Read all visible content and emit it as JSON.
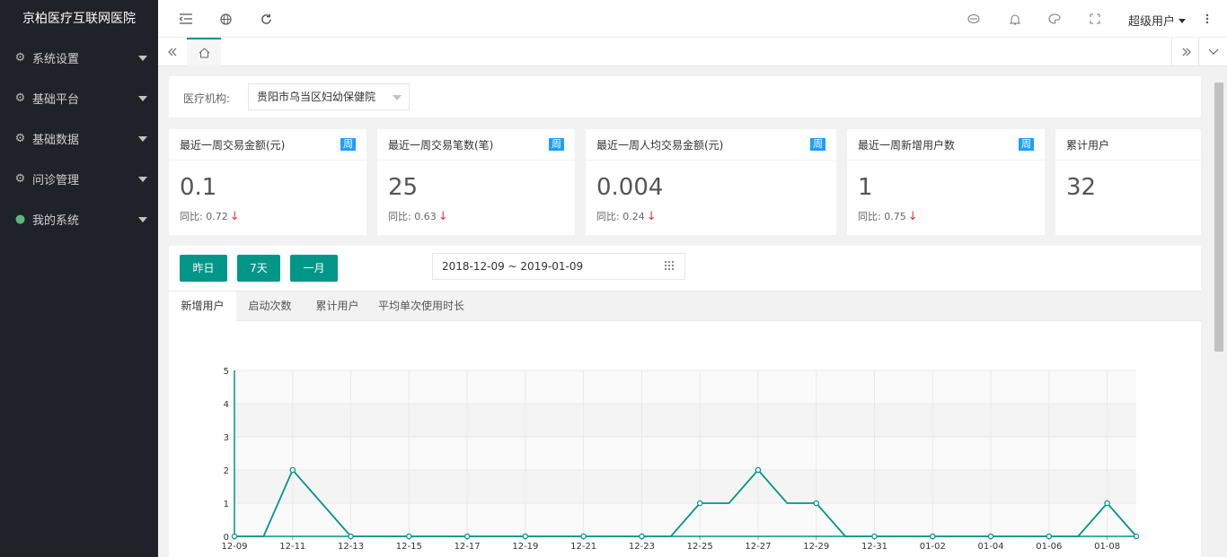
{
  "app": {
    "title": "京柏医疗互联网医院"
  },
  "sidebar": {
    "items": [
      {
        "label": "系统设置",
        "icon": "gear-icon"
      },
      {
        "label": "基础平台",
        "icon": "gear-icon"
      },
      {
        "label": "基础数据",
        "icon": "gear-icon"
      },
      {
        "label": "问诊管理",
        "icon": "gear-icon"
      },
      {
        "label": "我的系统",
        "icon": "wechat-icon"
      }
    ]
  },
  "header": {
    "user": "超级用户"
  },
  "filter": {
    "label": "医疗机构:",
    "selected": "贵阳市乌当区妇幼保健院"
  },
  "cards": [
    {
      "title": "最近一周交易金额(元)",
      "badge": "周",
      "value": "0.1",
      "yoy": "同比: 0.72"
    },
    {
      "title": "最近一周交易笔数(笔)",
      "badge": "周",
      "value": "25",
      "yoy": "同比: 0.63"
    },
    {
      "title": "最近一周人均交易金额(元)",
      "badge": "周",
      "value": "0.004",
      "yoy": "同比: 0.24"
    },
    {
      "title": "最近一周新增用户数",
      "badge": "周",
      "value": "1",
      "yoy": "同比: 0.75"
    },
    {
      "title": "累计用户",
      "value": "32"
    }
  ],
  "period_buttons": [
    "昨日",
    "7天",
    "一月"
  ],
  "date_range": "2018-12-09 ~ 2019-01-09",
  "chart_tabs": [
    "新增用户",
    "启动次数",
    "累计用户",
    "平均单次使用时长"
  ],
  "colors": {
    "accent": "#009688",
    "badge": "#1e9fff",
    "down_arrow": "#ff2a2a",
    "sidebar": "#20222a"
  },
  "chart_data": {
    "type": "line",
    "x": [
      "12-09",
      "12-10",
      "12-11",
      "12-12",
      "12-13",
      "12-14",
      "12-15",
      "12-16",
      "12-17",
      "12-18",
      "12-19",
      "12-20",
      "12-21",
      "12-22",
      "12-23",
      "12-24",
      "12-25",
      "12-26",
      "12-27",
      "12-28",
      "12-29",
      "12-30",
      "12-31",
      "01-01",
      "01-02",
      "01-03",
      "01-04",
      "01-05",
      "01-06",
      "01-07",
      "01-08",
      "01-09"
    ],
    "tick_labels": [
      "12-09",
      "12-11",
      "12-13",
      "12-15",
      "12-17",
      "12-19",
      "12-21",
      "12-23",
      "12-25",
      "12-27",
      "12-29",
      "12-31",
      "01-02",
      "01-04",
      "01-06",
      "01-08"
    ],
    "series": [
      {
        "values": [
          0,
          0,
          2,
          1,
          0,
          0,
          0,
          0,
          0,
          0,
          0,
          0,
          0,
          0,
          0,
          0,
          1,
          1,
          2,
          1,
          1,
          0,
          0,
          0,
          0,
          0,
          0,
          0,
          0,
          0,
          1,
          0
        ],
        "color": "#009688"
      }
    ],
    "markers_at": [
      0,
      2,
      4,
      6,
      8,
      10,
      12,
      14,
      16,
      18,
      20,
      22,
      24,
      26,
      28,
      30,
      31
    ],
    "ylim": [
      0,
      5
    ],
    "yticks": [
      0,
      1,
      2,
      3,
      4,
      5
    ],
    "grid": true
  }
}
